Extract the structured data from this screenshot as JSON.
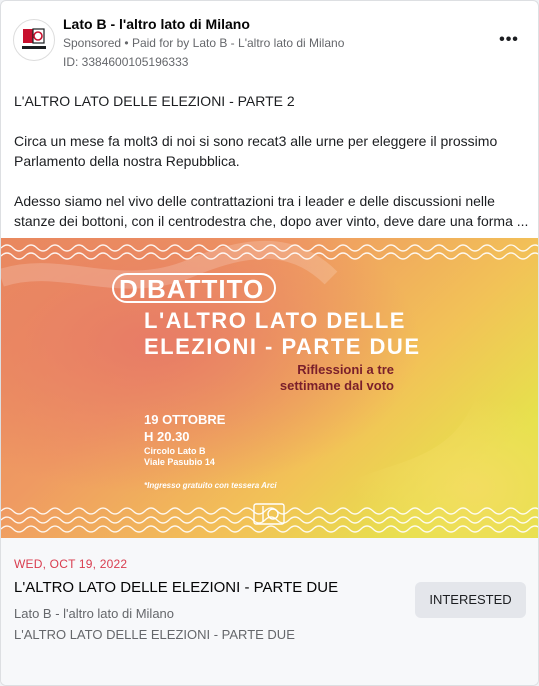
{
  "header": {
    "page_name": "Lato B - l'altro lato di Milano",
    "sponsored_label": "Sponsored",
    "dot": "•",
    "paid_prefix": "Paid for by",
    "paid_by": "Lato B - L'altro lato di Milano",
    "ad_id": "ID: 3384600105196333",
    "more_label": "•••",
    "logo_text": "LATO B"
  },
  "post": {
    "title": "L'ALTRO LATO DELLE ELEZIONI - PARTE 2",
    "p1_line1": "Circa un mese fa molt3 di noi si sono recat3 alle urne per eleggere il prossimo",
    "p1_line2": "Parlamento della nostra Repubblica.",
    "p2_line1": "Adesso siamo nel vivo delle contrattazioni tra i leader e delle discussioni nelle",
    "p2_line2": "stanze dei bottoni, con il centrodestra che, dopo aver vinto, deve dare una forma ..."
  },
  "banner": {
    "kicker": "DIBATTITO",
    "headline_1": "L'ALTRO LATO DELLE",
    "headline_2": "ELEZIONI - PARTE DUE",
    "tagline_1": "Riflessioni a tre",
    "tagline_2": "settimane dal voto",
    "date": "19 OTTOBRE",
    "time": "H 20.30",
    "venue": "Circolo Lato B",
    "address": "Viale Pasubio 14",
    "note": "*Ingresso gratuito con tessera Arci",
    "logo_text": "LATO B"
  },
  "event": {
    "date": "WED, OCT 19, 2022",
    "title": "L'ALTRO LATO DELLE ELEZIONI - PARTE DUE",
    "organizer": "Lato B - l'altro lato di Milano",
    "subtitle": "L'ALTRO LATO DELLE ELEZIONI - PARTE DUE",
    "button_label": "INTERESTED"
  },
  "colors": {
    "date_red": "#d93d4f",
    "button_bg": "#e4e6eb",
    "banner_orange": "#ef8a5c",
    "banner_yellow": "#eadf4a",
    "banner_maroon": "#7a1f2b"
  }
}
